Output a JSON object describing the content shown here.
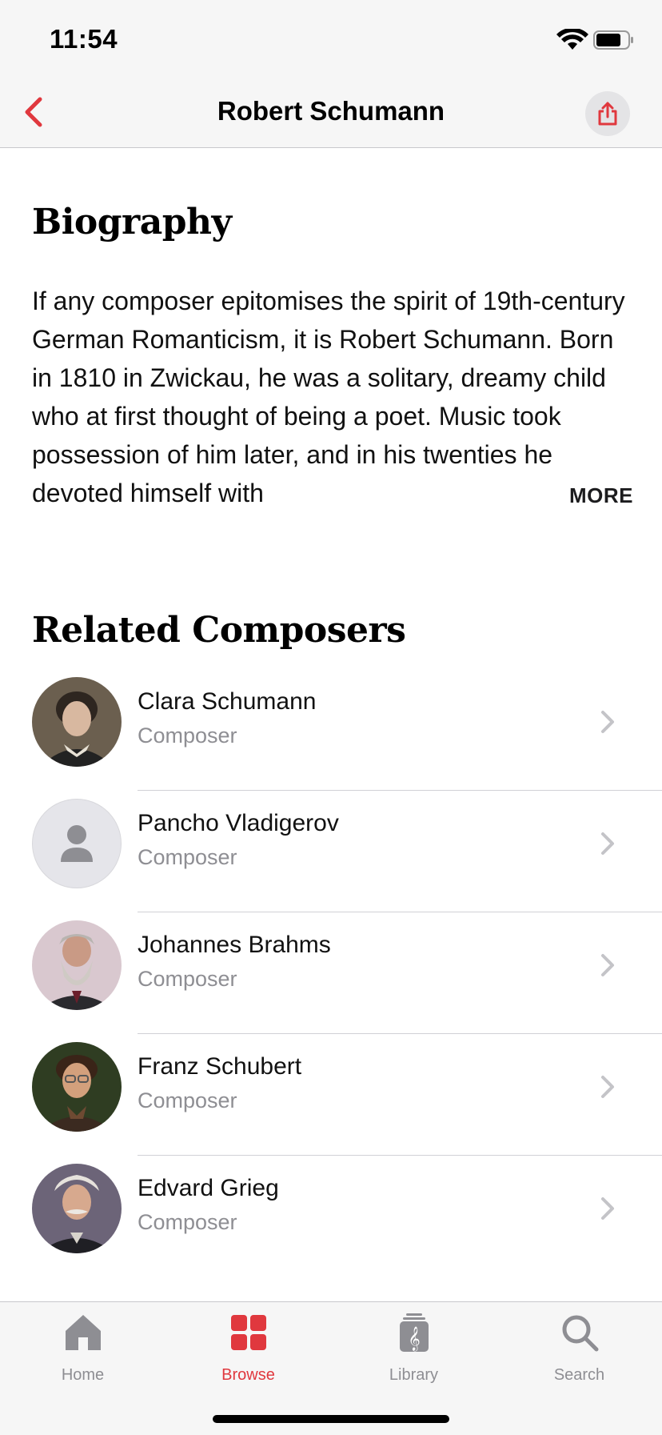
{
  "status_bar": {
    "time": "11:54"
  },
  "nav": {
    "title": "Robert Schumann"
  },
  "biography": {
    "heading": "Biography",
    "text": "If any composer epitomises the spirit of 19th-century German Romanticism, it is Robert Schumann. Born in 1810 in Zwickau, he was a solitary, dreamy child who at first thought of being a poet. Music took possession of him later, and in his twenties he devoted himself with",
    "more_label": "MORE"
  },
  "related": {
    "heading": "Related Composers",
    "items": [
      {
        "name": "Clara Schumann",
        "role": "Composer"
      },
      {
        "name": "Pancho Vladigerov",
        "role": "Composer"
      },
      {
        "name": "Johannes Brahms",
        "role": "Composer"
      },
      {
        "name": "Franz Schubert",
        "role": "Composer"
      },
      {
        "name": "Edvard Grieg",
        "role": "Composer"
      }
    ]
  },
  "tab_bar": {
    "items": [
      {
        "label": "Home",
        "icon": "home-icon"
      },
      {
        "label": "Browse",
        "icon": "grid-icon"
      },
      {
        "label": "Library",
        "icon": "library-icon"
      },
      {
        "label": "Search",
        "icon": "search-icon"
      }
    ],
    "active": "Browse"
  },
  "colors": {
    "accent": "#e0383e",
    "secondary_text": "#8e8e93"
  }
}
